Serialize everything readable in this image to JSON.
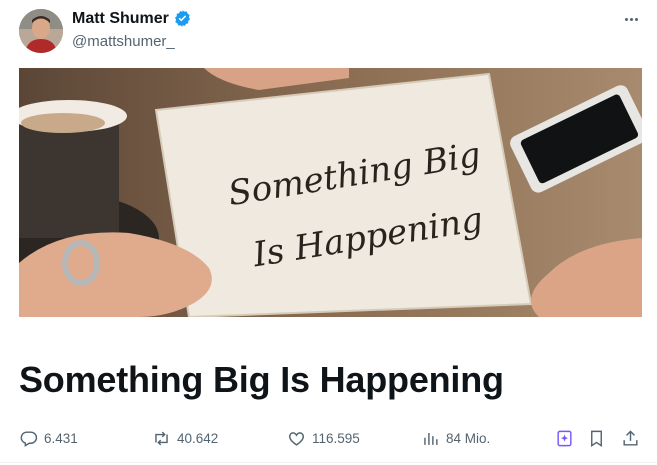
{
  "author": {
    "name": "Matt Shumer",
    "handle": "@mattshumer_",
    "verified": true
  },
  "media": {
    "card_text_line1": "Something Big",
    "card_text_line2": "Is Happening"
  },
  "article": {
    "title": "Something Big Is Happening"
  },
  "metrics": {
    "replies": "6.431",
    "reposts": "40.642",
    "likes": "116.595",
    "views": "84 Mio."
  },
  "colors": {
    "verified": "#1d9bf0",
    "icon_gray": "#536471",
    "grok_purple": "#7856ff"
  },
  "icons": {
    "reply": "speech-bubble-icon",
    "repost": "repost-arrows-icon",
    "like": "heart-icon",
    "views": "bar-chart-icon",
    "grok": "grok-icon",
    "bookmark": "bookmark-icon",
    "share": "share-icon",
    "more": "more-dots-icon"
  }
}
